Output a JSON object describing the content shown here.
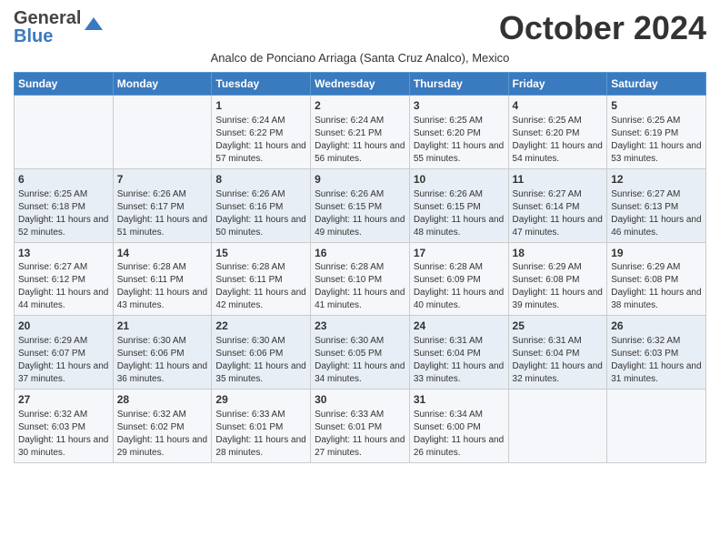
{
  "logo": {
    "general": "General",
    "blue": "Blue"
  },
  "title": "October 2024",
  "subtitle": "Analco de Ponciano Arriaga (Santa Cruz Analco), Mexico",
  "days_of_week": [
    "Sunday",
    "Monday",
    "Tuesday",
    "Wednesday",
    "Thursday",
    "Friday",
    "Saturday"
  ],
  "weeks": [
    [
      {
        "day": "",
        "info": ""
      },
      {
        "day": "",
        "info": ""
      },
      {
        "day": "1",
        "info": "Sunrise: 6:24 AM\nSunset: 6:22 PM\nDaylight: 11 hours and 57 minutes."
      },
      {
        "day": "2",
        "info": "Sunrise: 6:24 AM\nSunset: 6:21 PM\nDaylight: 11 hours and 56 minutes."
      },
      {
        "day": "3",
        "info": "Sunrise: 6:25 AM\nSunset: 6:20 PM\nDaylight: 11 hours and 55 minutes."
      },
      {
        "day": "4",
        "info": "Sunrise: 6:25 AM\nSunset: 6:20 PM\nDaylight: 11 hours and 54 minutes."
      },
      {
        "day": "5",
        "info": "Sunrise: 6:25 AM\nSunset: 6:19 PM\nDaylight: 11 hours and 53 minutes."
      }
    ],
    [
      {
        "day": "6",
        "info": "Sunrise: 6:25 AM\nSunset: 6:18 PM\nDaylight: 11 hours and 52 minutes."
      },
      {
        "day": "7",
        "info": "Sunrise: 6:26 AM\nSunset: 6:17 PM\nDaylight: 11 hours and 51 minutes."
      },
      {
        "day": "8",
        "info": "Sunrise: 6:26 AM\nSunset: 6:16 PM\nDaylight: 11 hours and 50 minutes."
      },
      {
        "day": "9",
        "info": "Sunrise: 6:26 AM\nSunset: 6:15 PM\nDaylight: 11 hours and 49 minutes."
      },
      {
        "day": "10",
        "info": "Sunrise: 6:26 AM\nSunset: 6:15 PM\nDaylight: 11 hours and 48 minutes."
      },
      {
        "day": "11",
        "info": "Sunrise: 6:27 AM\nSunset: 6:14 PM\nDaylight: 11 hours and 47 minutes."
      },
      {
        "day": "12",
        "info": "Sunrise: 6:27 AM\nSunset: 6:13 PM\nDaylight: 11 hours and 46 minutes."
      }
    ],
    [
      {
        "day": "13",
        "info": "Sunrise: 6:27 AM\nSunset: 6:12 PM\nDaylight: 11 hours and 44 minutes."
      },
      {
        "day": "14",
        "info": "Sunrise: 6:28 AM\nSunset: 6:11 PM\nDaylight: 11 hours and 43 minutes."
      },
      {
        "day": "15",
        "info": "Sunrise: 6:28 AM\nSunset: 6:11 PM\nDaylight: 11 hours and 42 minutes."
      },
      {
        "day": "16",
        "info": "Sunrise: 6:28 AM\nSunset: 6:10 PM\nDaylight: 11 hours and 41 minutes."
      },
      {
        "day": "17",
        "info": "Sunrise: 6:28 AM\nSunset: 6:09 PM\nDaylight: 11 hours and 40 minutes."
      },
      {
        "day": "18",
        "info": "Sunrise: 6:29 AM\nSunset: 6:08 PM\nDaylight: 11 hours and 39 minutes."
      },
      {
        "day": "19",
        "info": "Sunrise: 6:29 AM\nSunset: 6:08 PM\nDaylight: 11 hours and 38 minutes."
      }
    ],
    [
      {
        "day": "20",
        "info": "Sunrise: 6:29 AM\nSunset: 6:07 PM\nDaylight: 11 hours and 37 minutes."
      },
      {
        "day": "21",
        "info": "Sunrise: 6:30 AM\nSunset: 6:06 PM\nDaylight: 11 hours and 36 minutes."
      },
      {
        "day": "22",
        "info": "Sunrise: 6:30 AM\nSunset: 6:06 PM\nDaylight: 11 hours and 35 minutes."
      },
      {
        "day": "23",
        "info": "Sunrise: 6:30 AM\nSunset: 6:05 PM\nDaylight: 11 hours and 34 minutes."
      },
      {
        "day": "24",
        "info": "Sunrise: 6:31 AM\nSunset: 6:04 PM\nDaylight: 11 hours and 33 minutes."
      },
      {
        "day": "25",
        "info": "Sunrise: 6:31 AM\nSunset: 6:04 PM\nDaylight: 11 hours and 32 minutes."
      },
      {
        "day": "26",
        "info": "Sunrise: 6:32 AM\nSunset: 6:03 PM\nDaylight: 11 hours and 31 minutes."
      }
    ],
    [
      {
        "day": "27",
        "info": "Sunrise: 6:32 AM\nSunset: 6:03 PM\nDaylight: 11 hours and 30 minutes."
      },
      {
        "day": "28",
        "info": "Sunrise: 6:32 AM\nSunset: 6:02 PM\nDaylight: 11 hours and 29 minutes."
      },
      {
        "day": "29",
        "info": "Sunrise: 6:33 AM\nSunset: 6:01 PM\nDaylight: 11 hours and 28 minutes."
      },
      {
        "day": "30",
        "info": "Sunrise: 6:33 AM\nSunset: 6:01 PM\nDaylight: 11 hours and 27 minutes."
      },
      {
        "day": "31",
        "info": "Sunrise: 6:34 AM\nSunset: 6:00 PM\nDaylight: 11 hours and 26 minutes."
      },
      {
        "day": "",
        "info": ""
      },
      {
        "day": "",
        "info": ""
      }
    ]
  ]
}
